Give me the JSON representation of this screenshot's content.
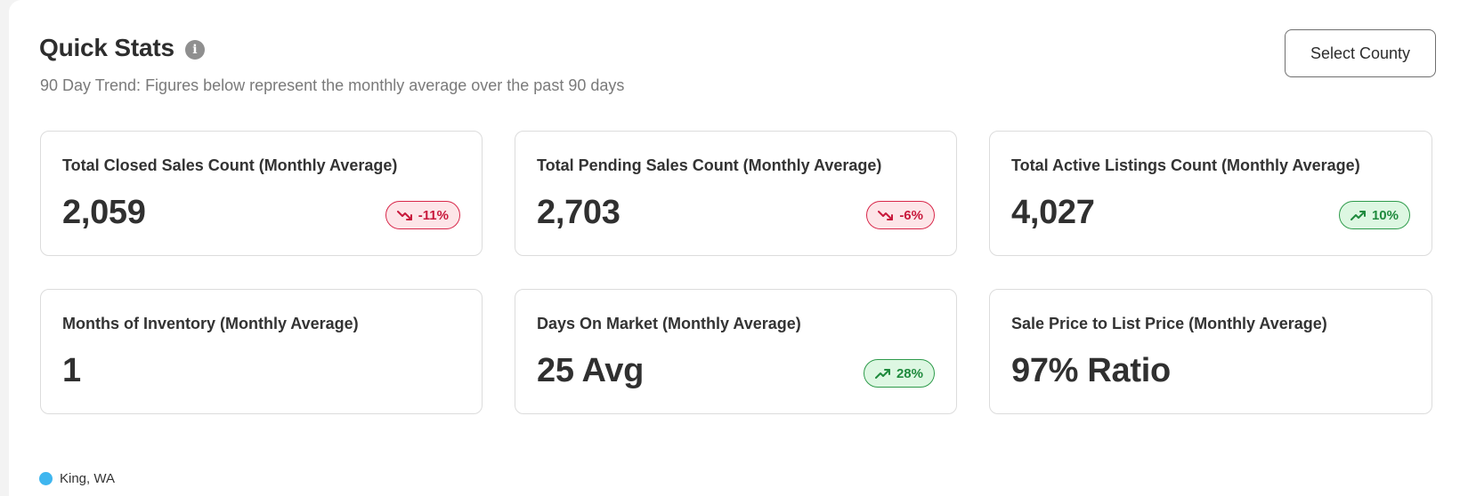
{
  "header": {
    "title": "Quick Stats",
    "subtitle": "90 Day Trend: Figures below represent the monthly average over the past 90 days",
    "info_icon": "info-icon",
    "select_button_label": "Select County"
  },
  "cards": [
    {
      "label": "Total Closed Sales Count (Monthly Average)",
      "value": "2,059",
      "badge": "-11%",
      "trend": "down"
    },
    {
      "label": "Total Pending Sales Count (Monthly Average)",
      "value": "2,703",
      "badge": "-6%",
      "trend": "down"
    },
    {
      "label": "Total Active Listings Count (Monthly Average)",
      "value": "4,027",
      "badge": "10%",
      "trend": "up"
    },
    {
      "label": "Months of Inventory (Monthly Average)",
      "value": "1"
    },
    {
      "label": "Days On Market (Monthly Average)",
      "value": "25 Avg",
      "badge": "28%",
      "trend": "up"
    },
    {
      "label": "Sale Price to List Price (Monthly Average)",
      "value": "97% Ratio"
    }
  ],
  "legend": {
    "label": "King, WA",
    "color": "#3fb6ef"
  },
  "colors": {
    "down": "#c8193c",
    "up": "#1f8a3d"
  }
}
